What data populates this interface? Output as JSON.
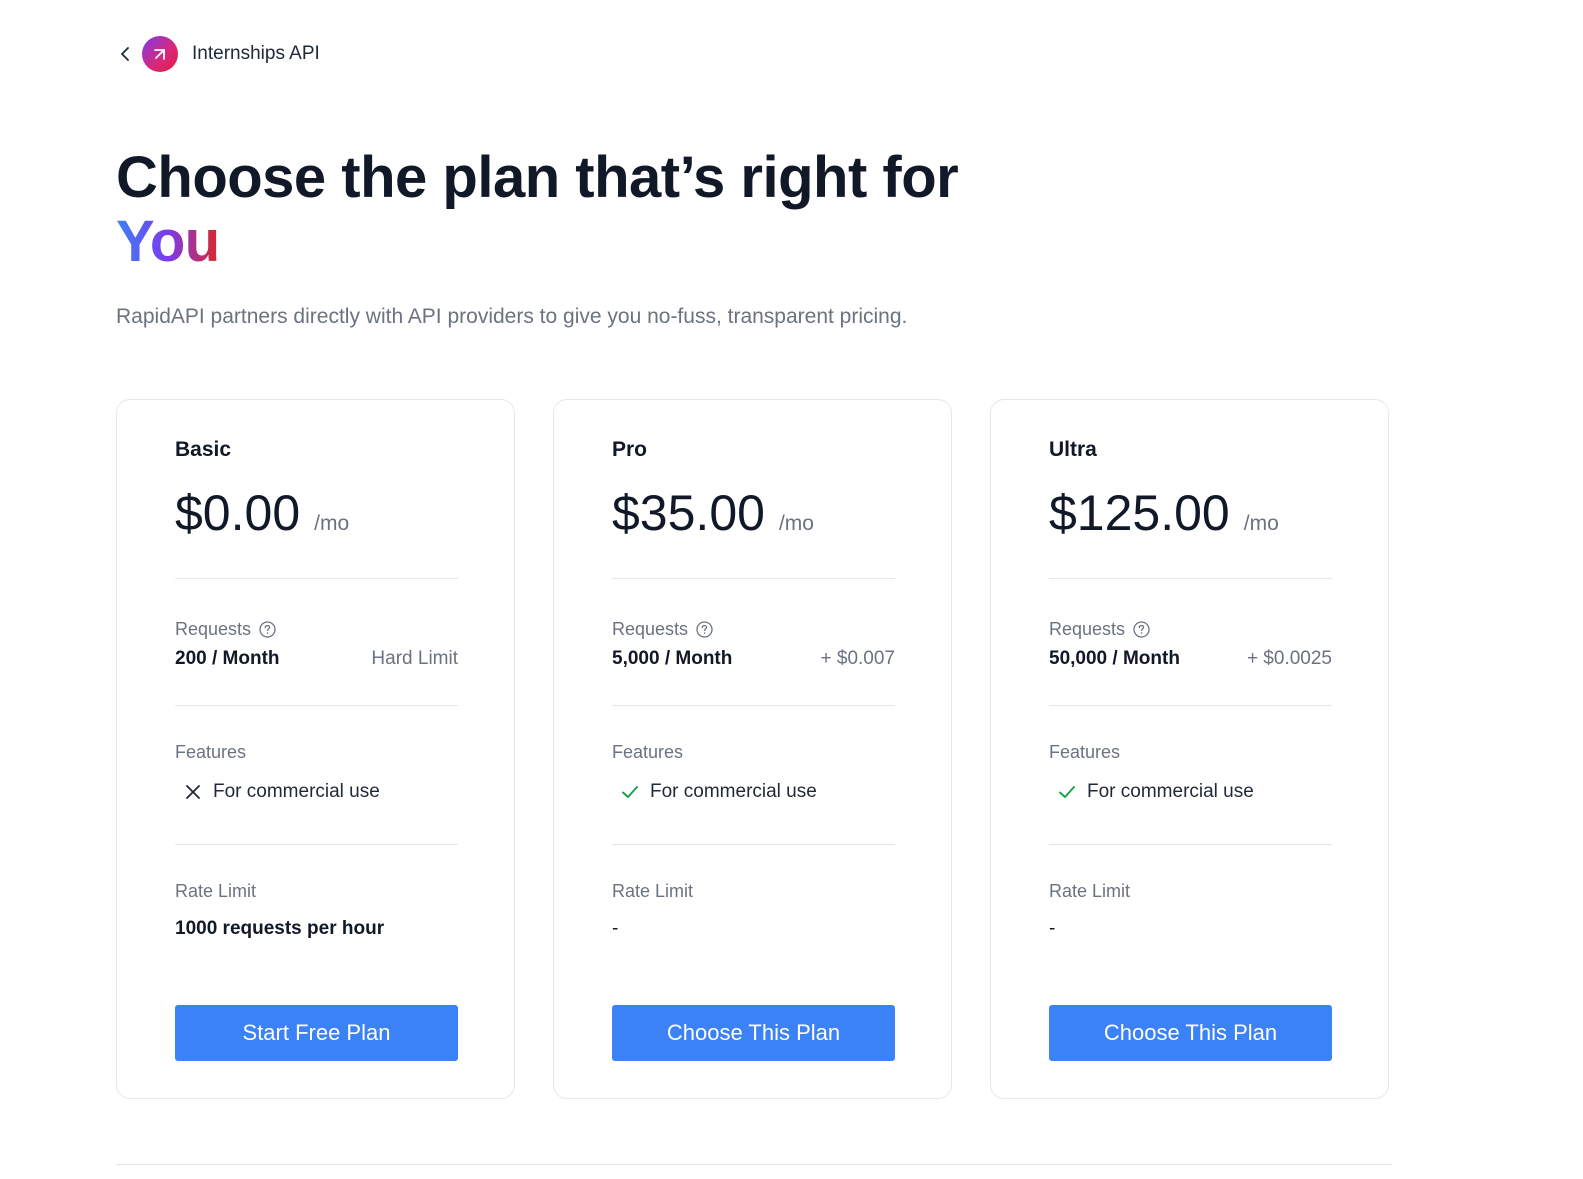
{
  "header": {
    "api_name": "Internships API",
    "back_icon": "chevron-left-icon",
    "logo_icon": "rapidapi-arrow-icon"
  },
  "hero": {
    "title_main": "Choose the plan that’s right for ",
    "title_highlight": "You",
    "subtitle": "RapidAPI partners directly with API providers to give you no-fuss, transparent pricing."
  },
  "labels": {
    "requests": "Requests",
    "features": "Features",
    "rate_limit": "Rate Limit"
  },
  "plans": [
    {
      "name": "Basic",
      "price": "$0.00",
      "period": "/mo",
      "requests": "200 / Month",
      "requests_extra": "Hard Limit",
      "feature": "For commercial use",
      "feature_included": false,
      "rate_limit": "1000 requests per hour",
      "button": "Start Free Plan"
    },
    {
      "name": "Pro",
      "price": "$35.00",
      "period": "/mo",
      "requests": "5,000 / Month",
      "requests_extra": "+ $0.007",
      "feature": "For commercial use",
      "feature_included": true,
      "rate_limit": "-",
      "button": "Choose This Plan"
    },
    {
      "name": "Ultra",
      "price": "$125.00",
      "period": "/mo",
      "requests": "50,000 / Month",
      "requests_extra": "+ $0.0025",
      "feature": "For commercial use",
      "feature_included": true,
      "rate_limit": "-",
      "button": "Choose This Plan"
    }
  ],
  "colors": {
    "accent": "#3b82f6",
    "check": "#16a34a",
    "muted_text": "#6b7280",
    "heading": "#111827"
  }
}
